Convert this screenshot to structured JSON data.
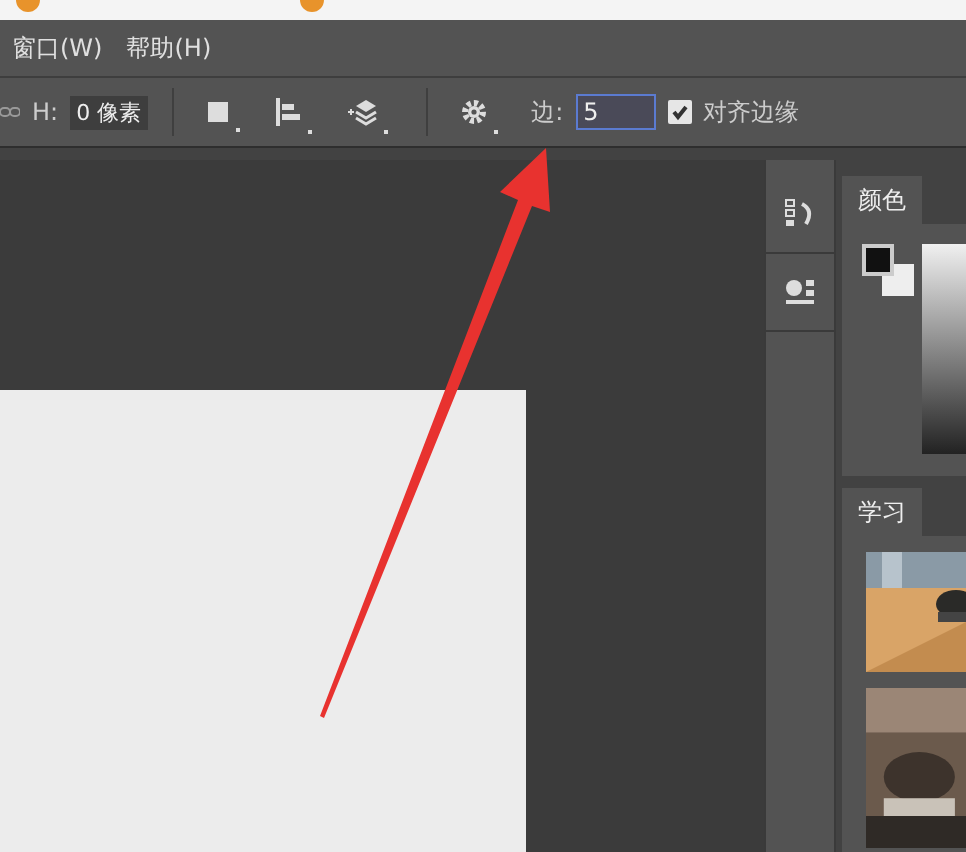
{
  "menu": [
    {
      "label": "窗口(W)"
    },
    {
      "label": "帮助(H)"
    }
  ],
  "options_bar": {
    "height_label": "H:",
    "height_value": "0 像素",
    "edge_label": "边:",
    "edge_value": "5",
    "edge_focused": true,
    "align_edges": {
      "label": "对齐边缘",
      "checked": true
    }
  },
  "panels": {
    "color_tab": {
      "label": "颜色",
      "selected": true
    },
    "learn_tab": {
      "label": "学习",
      "selected": true
    }
  }
}
